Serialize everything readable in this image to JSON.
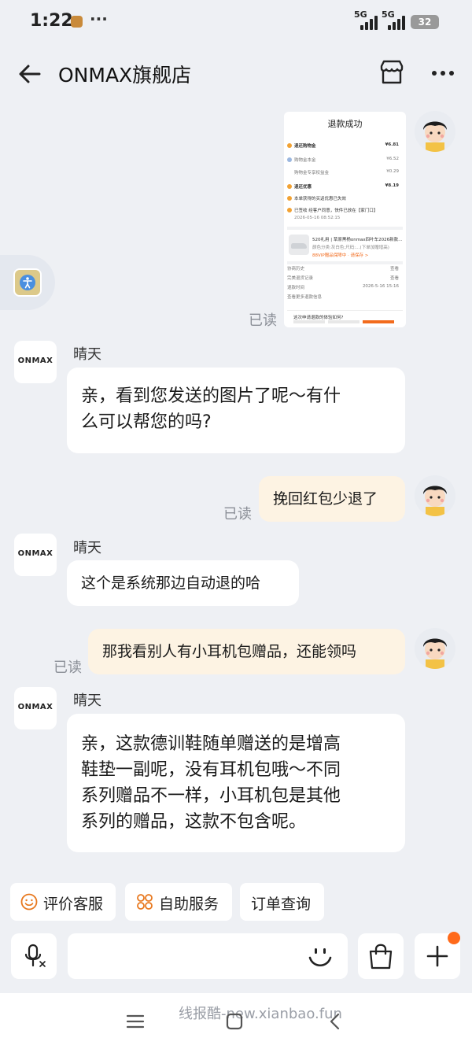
{
  "status_bar": {
    "time": "1:22",
    "dots": "···",
    "signal1": "5G",
    "signal2": "5G",
    "battery": "32"
  },
  "header": {
    "title": "ONMAX旗舰店"
  },
  "screenshot_card": {
    "title": "退款成功",
    "rows": [
      {
        "label": "退还购物金",
        "value": "¥6.81"
      },
      {
        "label": "购物金本金",
        "value": "¥6.52"
      },
      {
        "label": "购物金专享权益金",
        "value": "¥0.29"
      },
      {
        "label": "退还优惠",
        "value": "¥8.19"
      },
      {
        "label": "本单获得的买返优惠已失效",
        "value": ""
      },
      {
        "label": "已签收 经客户同意，快件已放在【家门口】",
        "value": ""
      },
      {
        "label": "2026-05-16 08:52:15",
        "value": ""
      }
    ],
    "product_title": "520礼用 | 草原黑杨onmax四叶车2026新款…",
    "product_spec": "颜色分类:灰白色;尺码:…(下单加赠增高)",
    "product_tag": "88VIP赠品保障中 · 请保存 >",
    "details": [
      {
        "label": "协商历史",
        "value": "查看"
      },
      {
        "label": "完美退货记录",
        "value": "查看"
      },
      {
        "label": "退款时间",
        "value": "2026-5-16 15:16"
      },
      {
        "label": "查看更多退款信息",
        "value": ""
      }
    ],
    "survey": "这次申请退款的体验如何?"
  },
  "messages": [
    {
      "from": "user",
      "kind": "image",
      "read": "已读"
    },
    {
      "from": "shop",
      "sender": "晴天",
      "lines": [
        "亲，看到您发送的图片了呢～有什",
        "么可以帮您的吗?"
      ]
    },
    {
      "from": "user",
      "text": "挽回红包少退了",
      "read": "已读"
    },
    {
      "from": "shop",
      "sender": "晴天",
      "lines": [
        "这个是系统那边自动退的哈"
      ]
    },
    {
      "from": "user",
      "text": "那我看别人有小耳机包赠品，还能领吗",
      "read": "已读"
    },
    {
      "from": "shop",
      "sender": "晴天",
      "lines": [
        "亲，这款德训鞋随单赠送的是增高",
        "鞋垫一副呢，没有耳机包哦～不同",
        "系列赠品不一样，小耳机包是其他",
        "系列的赠品，这款不包含呢。"
      ]
    }
  ],
  "shop_logo": "ONMAX",
  "quick_actions": [
    {
      "label": "评价客服",
      "icon": "smiley-icon"
    },
    {
      "label": "自助服务",
      "icon": "grid-icon"
    },
    {
      "label": "订单查询",
      "icon": ""
    }
  ],
  "input_bar": {
    "placeholder": ""
  },
  "nav_bar": {
    "watermark": "线报酷-new.xianbao.fun"
  },
  "colors": {
    "accent": "#ff6a1a",
    "user_bubble": "#fdf3e3",
    "background": "#eef0f4"
  }
}
